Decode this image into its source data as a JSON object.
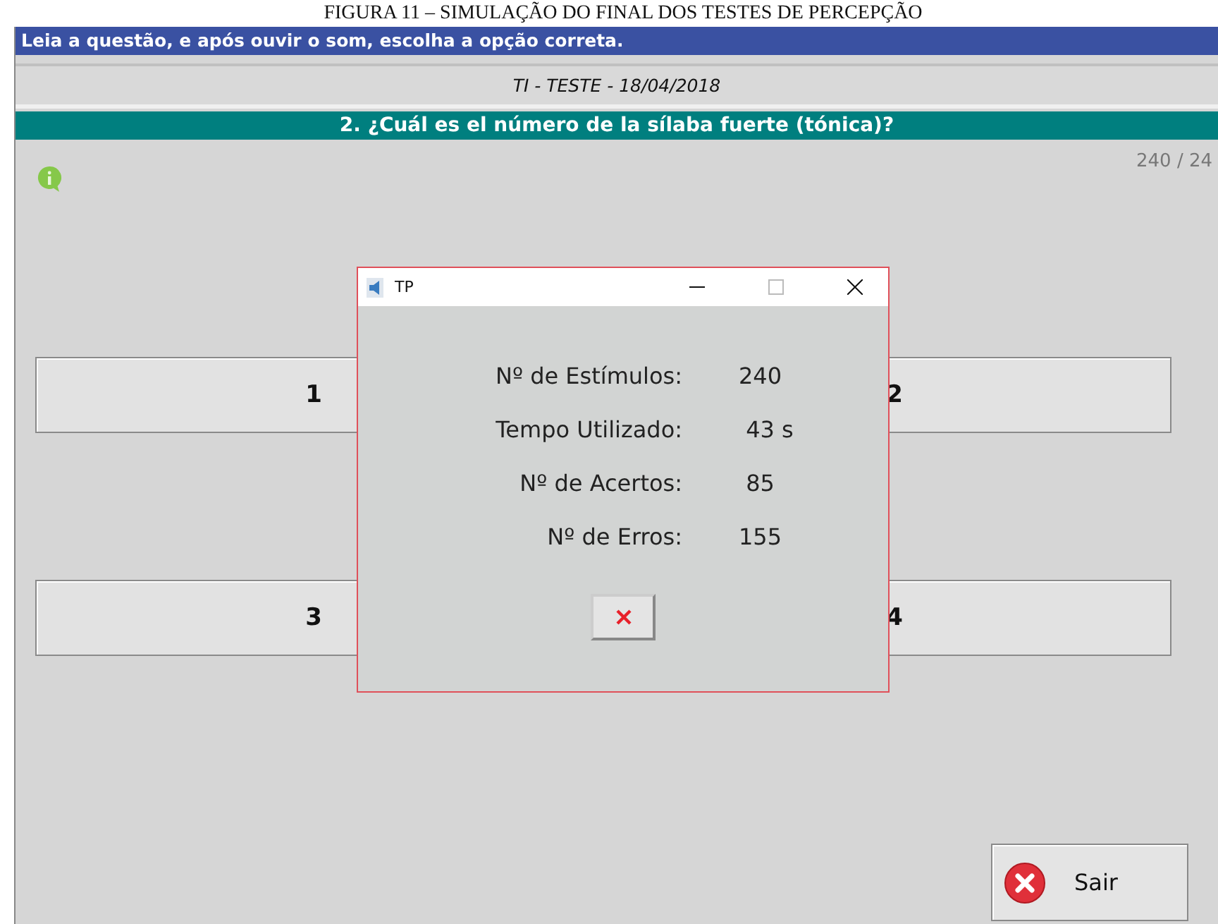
{
  "caption": "FIGURA 11 – SIMULAÇÃO DO FINAL DOS TESTES DE PERCEPÇÃO",
  "instruction_bar": "Leia a questão, e após ouvir o som, escolha a opção correta.",
  "test_name": "TI - TESTE - 18/04/2018",
  "question": "2. ¿Cuál es el número de la sílaba fuerte (tónica)?",
  "counter": "240 / 24",
  "answers": [
    "1",
    "2",
    "3",
    "4"
  ],
  "exit_button": "Sair",
  "dialog": {
    "title": "TP",
    "rows": [
      {
        "label": "Nº de Estímulos:",
        "value": "240"
      },
      {
        "label": "Tempo Utilizado:",
        "value": " 43 s"
      },
      {
        "label": "Nº de Acertos:",
        "value": " 85"
      },
      {
        "label": "Nº de Erros:",
        "value": "155"
      }
    ]
  }
}
